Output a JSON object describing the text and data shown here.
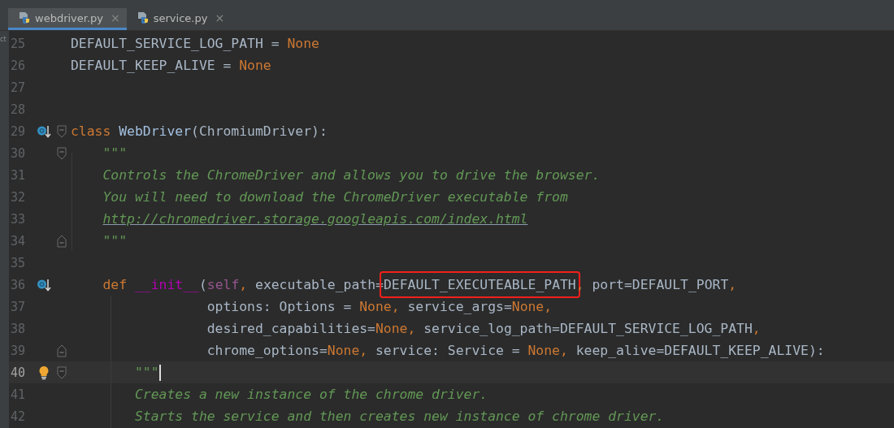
{
  "side_panel": {
    "text": "ct"
  },
  "tabs": [
    {
      "label": "webdriver.py",
      "close": "×",
      "selected": true
    },
    {
      "label": "service.py",
      "close": "×",
      "selected": false
    }
  ],
  "lines": [
    {
      "number": "25",
      "tokens": [
        {
          "text": "DEFAULT_SERVICE_LOG_PATH = ",
          "kind": "plain"
        },
        {
          "text": "None",
          "kind": "keyword"
        }
      ]
    },
    {
      "number": "26",
      "tokens": [
        {
          "text": "DEFAULT_KEEP_ALIVE = ",
          "kind": "plain"
        },
        {
          "text": "None",
          "kind": "keyword"
        }
      ]
    },
    {
      "number": "27"
    },
    {
      "number": "28"
    },
    {
      "number": "29",
      "gutter_icon": {
        "kind": "override"
      },
      "fold_marker": {
        "kind": "start"
      },
      "tokens": [
        {
          "text": "class ",
          "kind": "keyword"
        },
        {
          "text": "WebDriver",
          "kind": "classname"
        },
        {
          "text": "(ChromiumDriver):",
          "kind": "plain"
        }
      ]
    },
    {
      "number": "30",
      "fold_marker": {
        "kind": "start"
      },
      "tokens": [
        {
          "text": "    \"\"\"",
          "kind": "doc"
        }
      ]
    },
    {
      "number": "31",
      "tokens": [
        {
          "text": "    Controls the ChromeDriver and allows you to drive the browser.",
          "kind": "doc"
        }
      ]
    },
    {
      "number": "32",
      "tokens": [
        {
          "text": "    You will need to download the ChromeDriver executable from",
          "kind": "doc"
        }
      ]
    },
    {
      "number": "33",
      "tokens": [
        {
          "text": "    http://chromedriver.storage.googleapis.com/index.html",
          "kind": "link"
        }
      ]
    },
    {
      "number": "34",
      "fold_marker": {
        "kind": "end"
      },
      "tokens": [
        {
          "text": "    \"\"\"",
          "kind": "doc"
        }
      ]
    },
    {
      "number": "35"
    },
    {
      "number": "36",
      "gutter_icon": {
        "kind": "override"
      },
      "tokens": [
        {
          "text": "    def ",
          "kind": "keyword"
        },
        {
          "text": "__init__",
          "kind": "magic"
        },
        {
          "text": "(",
          "kind": "plain"
        },
        {
          "text": "self",
          "kind": "self"
        },
        {
          "text": ", ",
          "kind": "keyword"
        },
        {
          "text": "executable_path=",
          "kind": "plain"
        },
        {
          "text": "DEFAULT_EXECUTEABLE_PATH",
          "kind": "plain",
          "boxed": true
        },
        {
          "text": ", ",
          "kind": "keyword"
        },
        {
          "text": "port=DEFAULT_PORT",
          "kind": "plain"
        },
        {
          "text": ",",
          "kind": "keyword"
        }
      ]
    },
    {
      "number": "37",
      "tokens": [
        {
          "text": "                 options: Options = ",
          "kind": "plain"
        },
        {
          "text": "None, ",
          "kind": "keyword"
        },
        {
          "text": "service_args=",
          "kind": "plain"
        },
        {
          "text": "None,",
          "kind": "keyword"
        }
      ]
    },
    {
      "number": "38",
      "tokens": [
        {
          "text": "                 desired_capabilities=",
          "kind": "plain"
        },
        {
          "text": "None, ",
          "kind": "keyword"
        },
        {
          "text": "service_log_path=DEFAULT_SERVICE_LOG_PATH",
          "kind": "plain"
        },
        {
          "text": ",",
          "kind": "keyword"
        }
      ]
    },
    {
      "number": "39",
      "fold_marker": {
        "kind": "end"
      },
      "tokens": [
        {
          "text": "                 chrome_options=",
          "kind": "plain"
        },
        {
          "text": "None, ",
          "kind": "keyword"
        },
        {
          "text": "service: Service = ",
          "kind": "plain"
        },
        {
          "text": "None, ",
          "kind": "keyword"
        },
        {
          "text": "keep_alive=DEFAULT_KEEP_ALIVE):",
          "kind": "plain"
        }
      ]
    },
    {
      "number": "40",
      "gutter_icon": {
        "kind": "bulb"
      },
      "fold_marker": {
        "kind": "start"
      },
      "current": true,
      "tokens": [
        {
          "text": "        \"\"\"",
          "kind": "doc"
        }
      ]
    },
    {
      "number": "41",
      "tokens": [
        {
          "text": "        Creates a new instance of the chrome driver.",
          "kind": "doc"
        }
      ]
    },
    {
      "number": "42",
      "tokens": [
        {
          "text": "        Starts the service and then creates new instance of chrome driver.",
          "kind": "doc"
        }
      ]
    }
  ]
}
